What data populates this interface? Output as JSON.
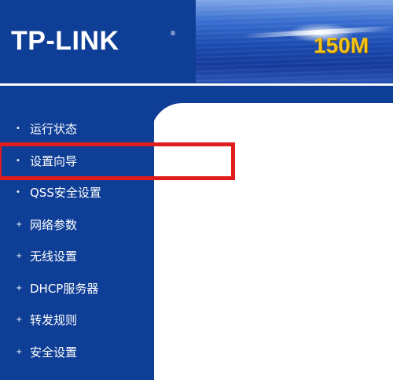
{
  "header": {
    "logo": "TP-LINK",
    "logo_reg": "®",
    "banner_text": "150M"
  },
  "sidebar": {
    "items": [
      {
        "label": "运行状态",
        "bullet": "•"
      },
      {
        "label": "设置向导",
        "bullet": "•"
      },
      {
        "label": "QSS安全设置",
        "bullet": "•"
      },
      {
        "label": "网络参数",
        "bullet": "+"
      },
      {
        "label": "无线设置",
        "bullet": "+"
      },
      {
        "label": "DHCP服务器",
        "bullet": "+"
      },
      {
        "label": "转发规则",
        "bullet": "+"
      },
      {
        "label": "安全设置",
        "bullet": "+"
      }
    ]
  },
  "colors": {
    "nav_background": "#0f3e96",
    "highlight": "#e01c1c",
    "banner_text": "#f2c21a"
  }
}
